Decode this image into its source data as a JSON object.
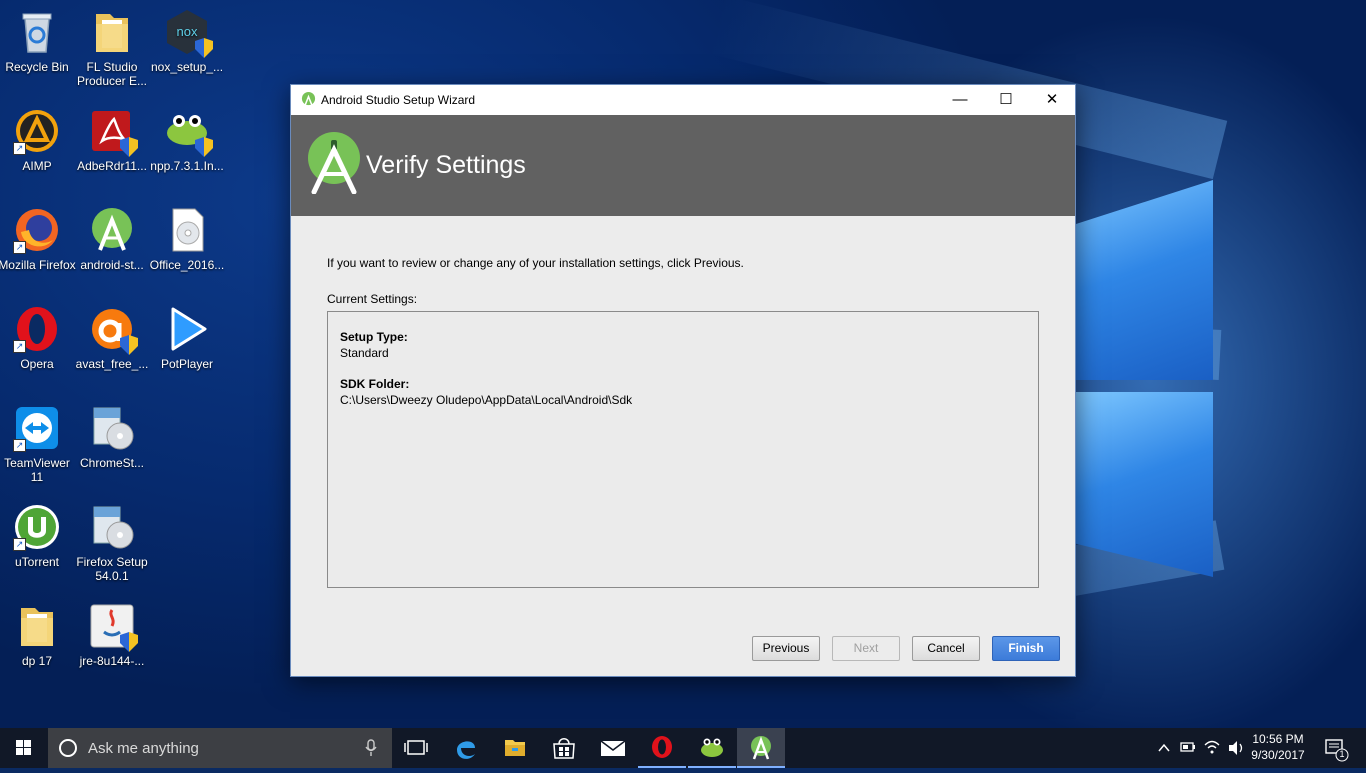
{
  "desktop": {
    "icons": [
      {
        "label": "Recycle Bin",
        "icon": "recycle-bin-icon"
      },
      {
        "label": "FL Studio Producer E...",
        "icon": "folder-icon"
      },
      {
        "label": "nox_setup_...",
        "icon": "nox-installer-icon"
      },
      {
        "label": "AIMP",
        "icon": "aimp-icon"
      },
      {
        "label": "AdbeRdr11...",
        "icon": "adobe-reader-installer-icon"
      },
      {
        "label": "npp.7.3.1.In...",
        "icon": "notepad-plus-plus-installer-icon"
      },
      {
        "label": "Mozilla Firefox",
        "icon": "firefox-icon"
      },
      {
        "label": "android-st...",
        "icon": "android-studio-installer-icon"
      },
      {
        "label": "Office_2016...",
        "icon": "disc-image-icon"
      },
      {
        "label": "Opera",
        "icon": "opera-icon"
      },
      {
        "label": "avast_free_...",
        "icon": "avast-installer-icon"
      },
      {
        "label": "PotPlayer",
        "icon": "potplayer-icon"
      },
      {
        "label": "TeamViewer 11",
        "icon": "teamviewer-icon"
      },
      {
        "label": "ChromeSt...",
        "icon": "setup-installer-icon"
      },
      {
        "label": "uTorrent",
        "icon": "utorrent-icon"
      },
      {
        "label": "Firefox Setup 54.0.1",
        "icon": "setup-installer-icon"
      },
      {
        "label": "dp 17",
        "icon": "folder-icon"
      },
      {
        "label": "jre-8u144-...",
        "icon": "java-installer-icon"
      }
    ]
  },
  "window": {
    "title": "Android Studio Setup Wizard",
    "controls": {
      "minimize": "—",
      "maximize": "☐",
      "close": "✕"
    },
    "header_title": "Verify Settings",
    "intro_text": "If you want to review or change any of your installation settings, click Previous.",
    "current_settings_label": "Current Settings:",
    "settings": [
      {
        "key": "Setup Type:",
        "value": "Standard"
      },
      {
        "key": "SDK Folder:",
        "value": "C:\\Users\\Dweezy Oludepo\\AppData\\Local\\Android\\Sdk"
      }
    ],
    "buttons": {
      "previous": "Previous",
      "next": "Next",
      "cancel": "Cancel",
      "finish": "Finish"
    }
  },
  "taskbar": {
    "search_placeholder": "Ask me anything",
    "pinned": [
      "task-view-icon",
      "edge-icon",
      "file-explorer-icon",
      "store-icon",
      "mail-icon",
      "opera-icon",
      "notepad-plus-plus-icon",
      "android-studio-icon"
    ],
    "clock_time": "10:56 PM",
    "clock_date": "9/30/2017",
    "notification_count": "1"
  },
  "colors": {
    "header_bg": "#616161",
    "finish_button": "#3c7bd9",
    "android_green": "#78c257",
    "taskbar_bg": "#111827"
  }
}
